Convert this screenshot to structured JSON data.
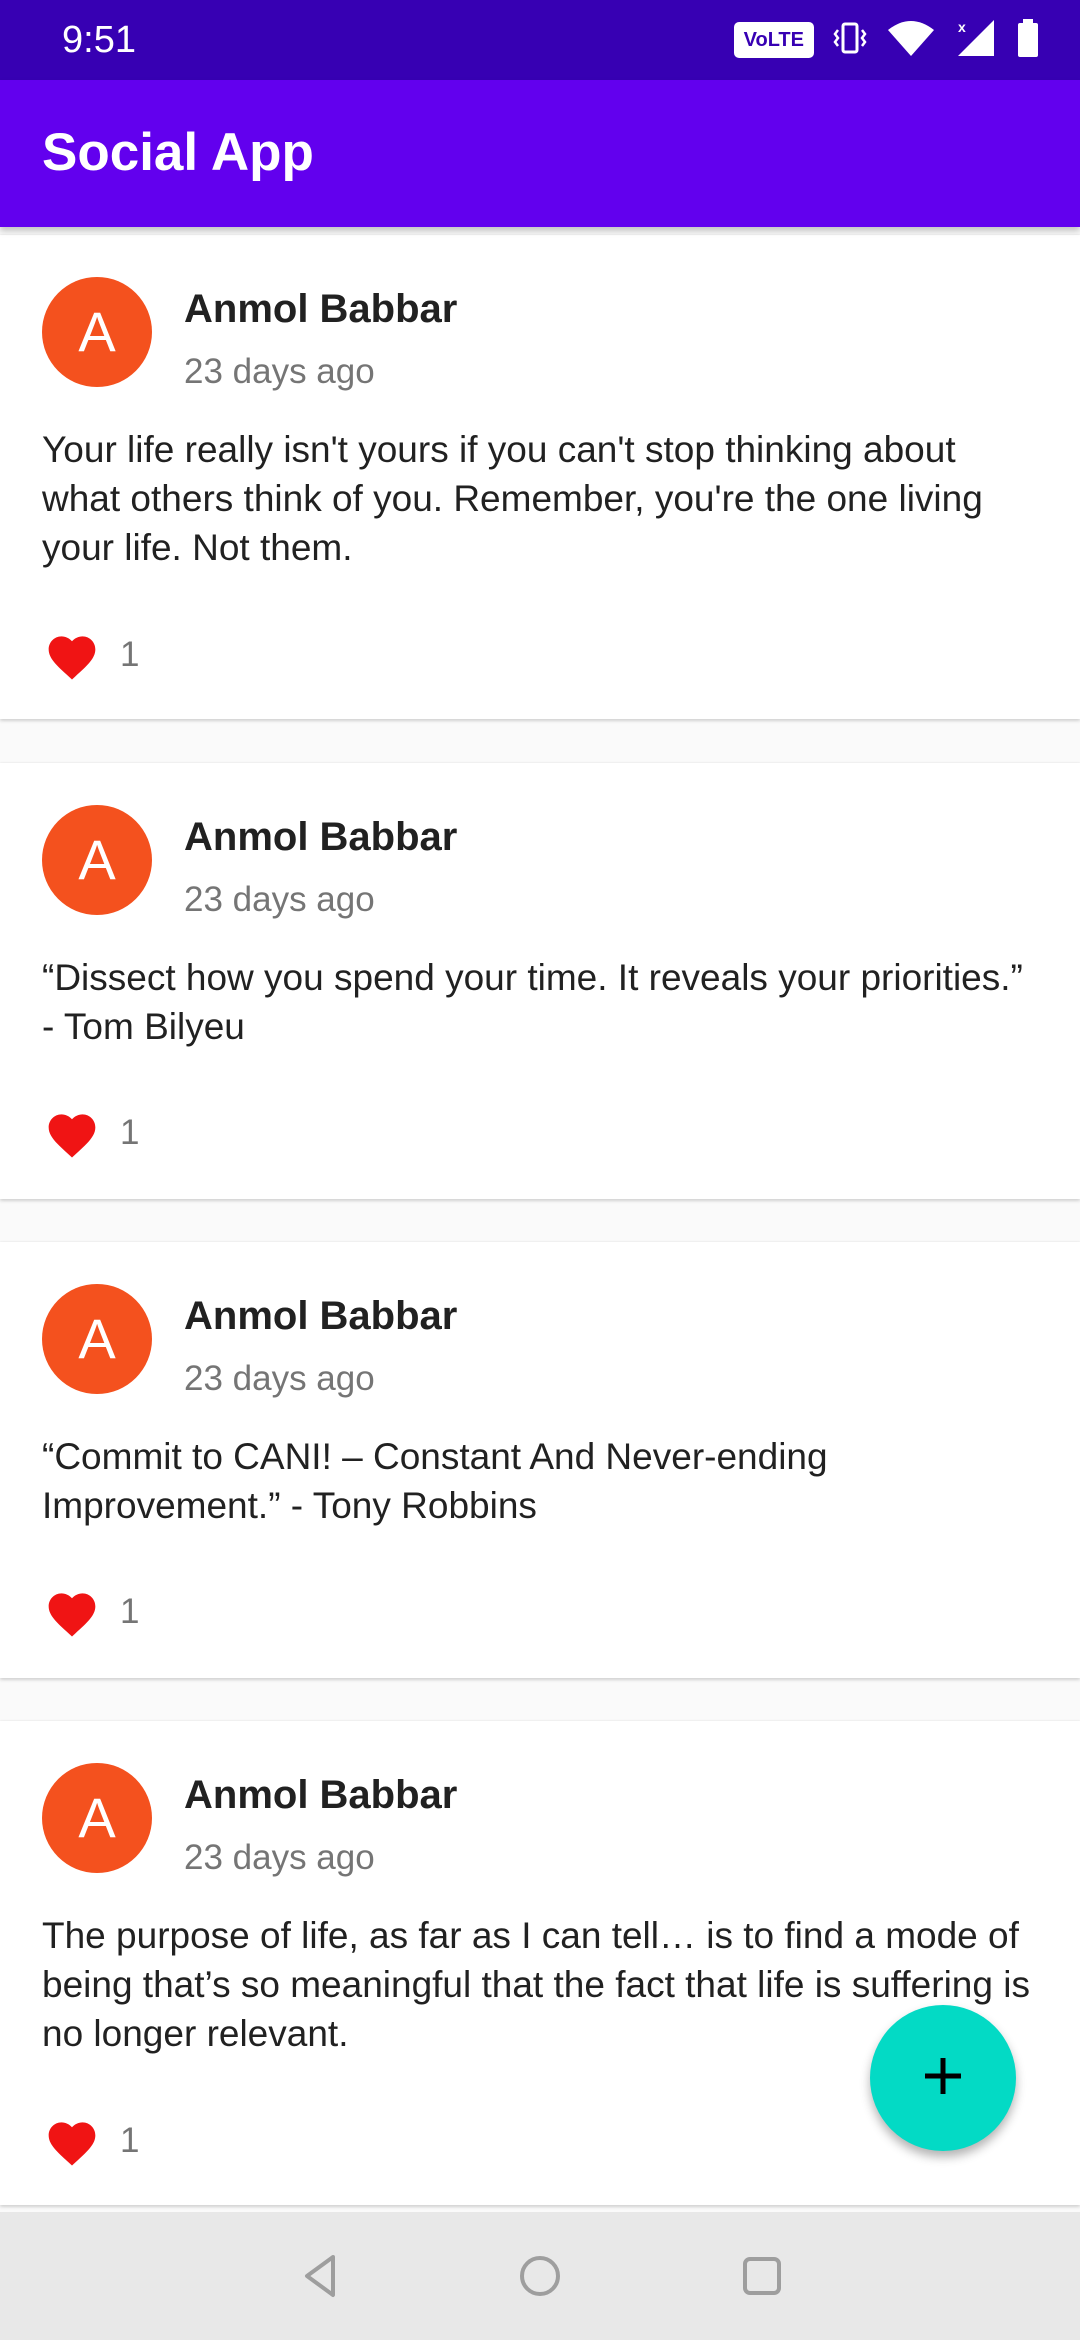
{
  "status_bar": {
    "time": "9:51",
    "network_badge": "VoLTE",
    "icons": [
      "vibrate-icon",
      "wifi-icon",
      "cellular-signal-icon",
      "battery-icon"
    ]
  },
  "app_bar": {
    "title": "Social App"
  },
  "posts": [
    {
      "avatar_letter": "A",
      "author": "Anmol Babbar",
      "time": "23 days ago",
      "text": "Your life really isn't yours if you can't stop thinking about what others think of you. Remember, you're the one living your life. Not them.",
      "likes": "1"
    },
    {
      "avatar_letter": "A",
      "author": "Anmol Babbar",
      "time": "23 days ago",
      "text": "“Dissect how you spend your time. It reveals your priorities.” - Tom Bilyeu",
      "likes": "1"
    },
    {
      "avatar_letter": "A",
      "author": "Anmol Babbar",
      "time": "23 days ago",
      "text": "“Commit to CANI! – Constant And Never-ending Improvement.” - Tony Robbins",
      "likes": "1"
    },
    {
      "avatar_letter": "A",
      "author": "Anmol Babbar",
      "time": "23 days ago",
      "text": "The purpose of life, as far as I can tell… is to find a mode of being that’s so meaningful that the fact that life is suffering is no longer relevant.",
      "likes": "1"
    }
  ],
  "fab": {
    "icon": "plus-icon"
  },
  "nav_bar": {
    "icons": [
      "back-icon",
      "home-icon",
      "recents-icon"
    ]
  },
  "colors": {
    "status_bar": "#3700b3",
    "app_bar": "#6200ee",
    "avatar": "#f4511e",
    "heart": "#f01414",
    "fab": "#03dac5"
  }
}
